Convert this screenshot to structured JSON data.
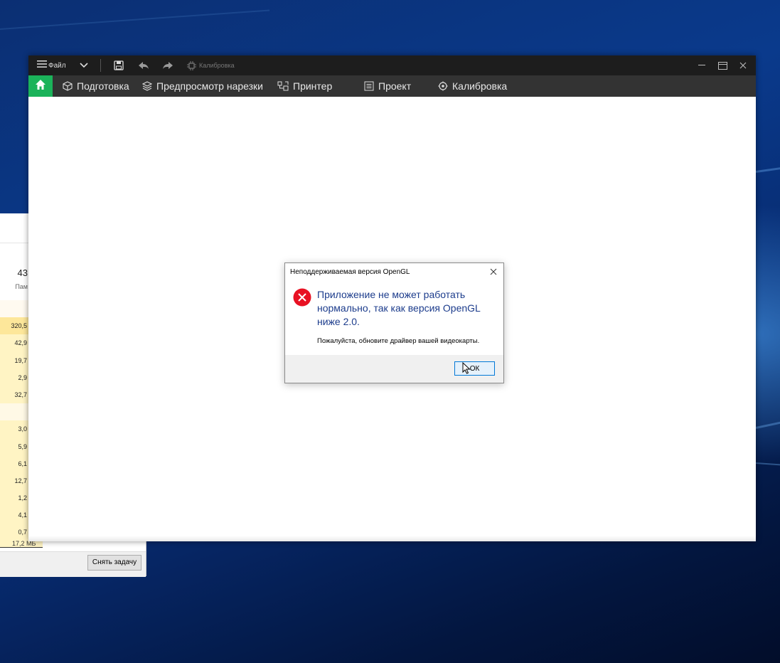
{
  "desktop": {
    "accent": "#0a3a8c"
  },
  "task_manager": {
    "header_value": "43",
    "header_sub": "Пам",
    "rows": [
      {
        "value": "",
        "style": "blank"
      },
      {
        "value": "320,5",
        "style": "strong"
      },
      {
        "value": "42,9",
        "style": "normal"
      },
      {
        "value": "19,7",
        "style": "normal"
      },
      {
        "value": "2,9",
        "style": "normal"
      },
      {
        "value": "32,7",
        "style": "normal"
      },
      {
        "value": "",
        "style": "gap"
      },
      {
        "value": "3,0",
        "style": "normal"
      },
      {
        "value": "5,9",
        "style": "normal"
      },
      {
        "value": "6,1",
        "style": "normal"
      },
      {
        "value": "12,7",
        "style": "normal"
      },
      {
        "value": "1,2",
        "style": "normal"
      },
      {
        "value": "4,1",
        "style": "normal"
      },
      {
        "value": "0,7",
        "style": "normal"
      }
    ],
    "last_row": "17,2 МБ",
    "end_task_button": "Снять задачу"
  },
  "app": {
    "titlebar": {
      "menu_label": "Файл",
      "title": "Калибровка",
      "icons": [
        "menu-icon",
        "chevron-down-icon",
        "save-icon",
        "undo-icon",
        "redo-icon",
        "calibration-icon"
      ]
    },
    "tabs": [
      {
        "label": "Подготовка",
        "icon": "cube-icon"
      },
      {
        "label": "Предпросмотр нарезки",
        "icon": "layers-icon"
      },
      {
        "label": "Принтер",
        "icon": "printer-icon"
      },
      {
        "label": "Проект",
        "icon": "project-icon"
      },
      {
        "label": "Калибровка",
        "icon": "calibration-icon"
      }
    ],
    "home_color": "#1bb35a"
  },
  "dialog": {
    "title": "Неподдерживаемая версия OpenGL",
    "message": "Приложение не может работать нормально, так как версия OpenGL ниже 2.0.",
    "hint": "Пожалуйста, обновите драйвер вашей видеокарты.",
    "ok_label": "ОК",
    "error_color": "#e81123",
    "message_color": "#1c3c8c"
  }
}
